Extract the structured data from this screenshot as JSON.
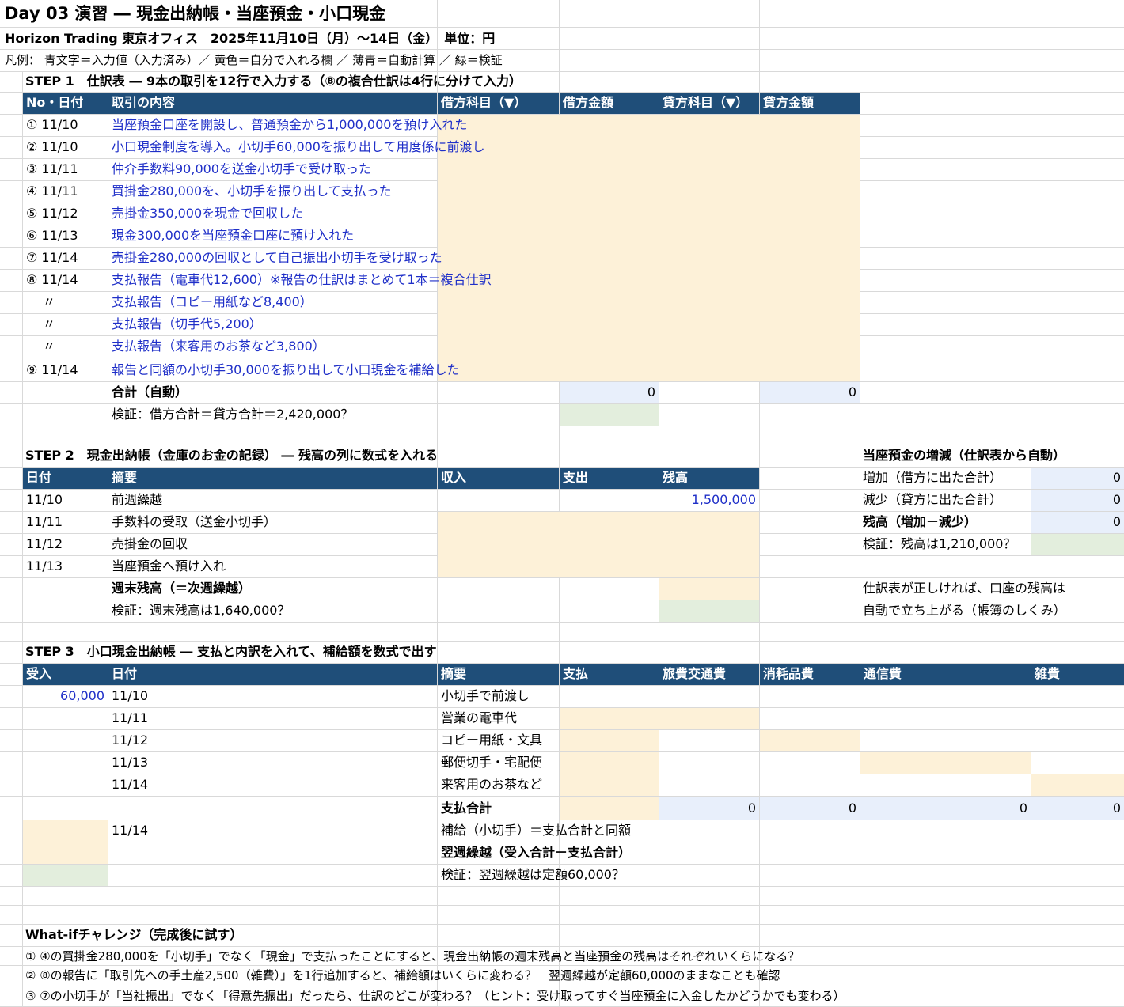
{
  "header": {
    "title": "Day 03 演習 ― 現金出納帳・当座預金・小口現金",
    "subtitle": "Horizon Trading 東京オフィス　2025年11月10日（月）～14日（金）　単位：円",
    "legend": "凡例：  青文字＝入力値（入力済み）／ 黄色＝自分で入れる欄 ／ 薄青＝自動計算 ／ 緑＝検証"
  },
  "step1": {
    "title": "STEP 1　仕訳表 ― 9本の取引を12行で入力する（⑧の複合仕訳は4行に分けて入力）",
    "headers": [
      "No・日付",
      "取引の内容",
      "借方科目（▼）",
      "借方金額",
      "貸方科目（▼）",
      "貸方金額"
    ],
    "rows": [
      {
        "no": "① 11/10",
        "desc": "当座預金口座を開設し、普通預金から1,000,000を預け入れた"
      },
      {
        "no": "② 11/10",
        "desc": "小口現金制度を導入。小切手60,000を振り出して用度係に前渡し"
      },
      {
        "no": "③ 11/11",
        "desc": "仲介手数料90,000を送金小切手で受け取った"
      },
      {
        "no": "④ 11/11",
        "desc": "買掛金280,000を、小切手を振り出して支払った"
      },
      {
        "no": "⑤ 11/12",
        "desc": "売掛金350,000を現金で回収した"
      },
      {
        "no": "⑥ 11/13",
        "desc": "現金300,000を当座預金口座に預け入れた"
      },
      {
        "no": "⑦ 11/14",
        "desc": "売掛金280,000の回収として自己振出小切手を受け取った"
      },
      {
        "no": "⑧ 11/14",
        "desc": "支払報告（電車代12,600）※報告の仕訳はまとめて1本＝複合仕訳"
      },
      {
        "no": "〃",
        "desc": "支払報告（コピー用紙など8,400）"
      },
      {
        "no": "〃",
        "desc": "支払報告（切手代5,200）"
      },
      {
        "no": "〃",
        "desc": "支払報告（来客用のお茶など3,800）"
      },
      {
        "no": "⑨ 11/14",
        "desc": "報告と同額の小切手30,000を振り出して小口現金を補給した"
      }
    ],
    "total_label": "合計（自動）",
    "debit_total": "0",
    "credit_total": "0",
    "check_label": "検証：借方合計＝貸方合計＝2,420,000？"
  },
  "step2": {
    "title": "STEP 2　現金出納帳（金庫のお金の記録） ― 残高の列に数式を入れる",
    "headers": [
      "日付",
      "摘要",
      "収入",
      "支出",
      "残高"
    ],
    "rows": [
      {
        "date": "11/10",
        "desc": "前週繰越",
        "balance": "1,500,000"
      },
      {
        "date": "11/11",
        "desc": "手数料の受取（送金小切手）",
        "balance": ""
      },
      {
        "date": "11/12",
        "desc": "売掛金の回収",
        "balance": ""
      },
      {
        "date": "11/13",
        "desc": "当座預金へ預け入れ",
        "balance": ""
      }
    ],
    "end_label": "週末残高（＝次週繰越）",
    "check_label": "検証：週末残高は1,640,000？"
  },
  "bank": {
    "title": "当座預金の増減（仕訳表から自動）",
    "increase_label": "増加（借方に出た合計）",
    "increase_value": "0",
    "decrease_label": "減少（貸方に出た合計）",
    "decrease_value": "0",
    "balance_label": "残高（増加－減少）",
    "balance_value": "0",
    "check_label": "検証：残高は1,210,000？",
    "note1": "仕訳表が正しければ、口座の残高は",
    "note2": "自動で立ち上がる（帳簿のしくみ）"
  },
  "step3": {
    "title": "STEP 3　小口現金出納帳 ― 支払と内訳を入れて、補給額を数式で出す",
    "headers": [
      "受入",
      "日付",
      "摘要",
      "支払",
      "旅費交通費",
      "消耗品費",
      "通信費",
      "雑費"
    ],
    "rows": [
      {
        "receipt": "60,000",
        "date": "11/10",
        "desc": "小切手で前渡し"
      },
      {
        "receipt": "",
        "date": "11/11",
        "desc": "営業の電車代"
      },
      {
        "receipt": "",
        "date": "11/12",
        "desc": "コピー用紙・文具"
      },
      {
        "receipt": "",
        "date": "11/13",
        "desc": "郵便切手・宅配便"
      },
      {
        "receipt": "",
        "date": "11/14",
        "desc": "来客用のお茶など"
      }
    ],
    "total_label": "支払合計",
    "totals": [
      "0",
      "0",
      "0",
      "0"
    ],
    "replenish_date": "11/14",
    "replenish_label": "補給（小切手）＝支払合計と同額",
    "carry_label": "翌週繰越（受入合計－支払合計）",
    "check_label": "検証：翌週繰越は定額60,000？"
  },
  "whatif": {
    "title": "What-ifチャレンジ（完成後に試す）",
    "items": [
      "① ④の買掛金280,000を「小切手」でなく「現金」で支払ったことにすると、現金出納帳の週末残高と当座預金の残高はそれぞれいくらになる？",
      "② ⑧の報告に「取引先への手土産2,500（雑費）」を1行追加すると、補給額はいくらに変わる？　翌週繰越が定額60,000のままなことも確認",
      "③ ⑦の小切手が「当社振出」でなく「得意先振出」だったら、仕訳のどこが変わる？（ヒント：受け取ってすぐ当座預金に入金したかどうかでも変わる）"
    ]
  },
  "colors": {
    "header_fill": "#1f4e79",
    "input_blue_text": "#1f2fc8",
    "yellow_fill": "#fdf1d8",
    "calc_fill": "#e8effb",
    "check_fill": "#e3eedd"
  }
}
